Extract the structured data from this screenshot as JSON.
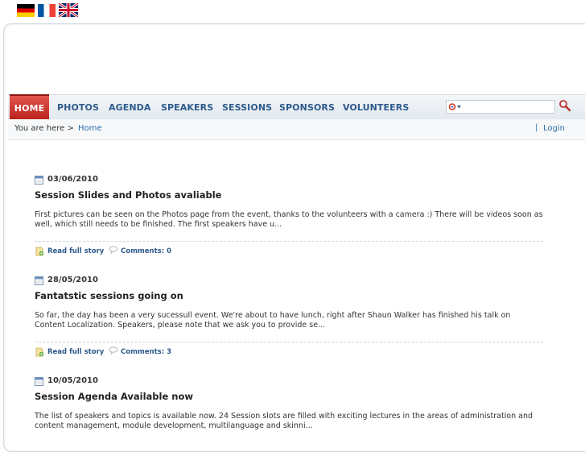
{
  "languages": [
    {
      "name": "German",
      "icon": "flag-germany-icon"
    },
    {
      "name": "French",
      "icon": "flag-france-icon"
    },
    {
      "name": "English",
      "icon": "flag-uk-icon"
    }
  ],
  "nav": {
    "items": [
      {
        "label": "HOME",
        "active": true
      },
      {
        "label": "PHOTOS",
        "active": false
      },
      {
        "label": "AGENDA",
        "active": false
      },
      {
        "label": "SPEAKERS",
        "active": false
      },
      {
        "label": "SESSIONS",
        "active": false
      },
      {
        "label": "SPONSORS",
        "active": false
      },
      {
        "label": "VOLUNTEERS",
        "active": false
      }
    ],
    "search": {
      "value": "",
      "placeholder": "",
      "engine_icon": "search-engine-icon",
      "go_icon": "search-go-icon"
    }
  },
  "breadcrumb": {
    "prefix": "You are here >",
    "home": "Home",
    "separator": "|",
    "login": "Login"
  },
  "news": [
    {
      "date": "03/06/2010",
      "title": "Session Slides and Photos avaliable",
      "summary": "First pictures can be seen on the Photos page from the event, thanks to the volunteers with a camera :) There will be videos soon as well, which still needs to be finished. The first speakers have u...",
      "read_more": "Read full story",
      "comments": "Comments: 0"
    },
    {
      "date": "28/05/2010",
      "title": "Fantatstic sessions going on",
      "summary": "So far, the day has been a very sucessull event. We're about to have lunch, right after Shaun Walker has finished his talk on Content Localization. Speakers, please note that we ask you to provide se...",
      "read_more": "Read full story",
      "comments": "Comments: 3"
    },
    {
      "date": "10/05/2010",
      "title": "Session Agenda Available now",
      "summary": "The list of speakers and topics is available now. 24 Session slots are filled with exciting lectures in the areas of administration and content management, module development, multilanguage and skinni...",
      "read_more": "",
      "comments": ""
    }
  ],
  "colors": {
    "nav_text": "#2d5a8c",
    "nav_active_bg": "#c8322c",
    "link": "#2d6ca8"
  }
}
